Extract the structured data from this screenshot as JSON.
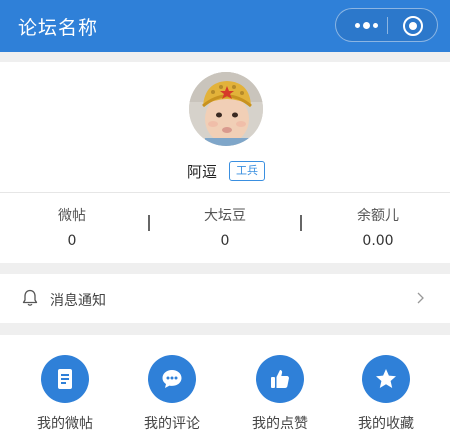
{
  "header": {
    "title": "论坛名称",
    "brand_color": "#2f80d8",
    "capsule": {
      "more_icon": "more-dots-icon",
      "close_icon": "target-close-icon"
    }
  },
  "profile": {
    "avatar_icon": "avatar-photo",
    "username": "阿逗",
    "rank": "工兵"
  },
  "stats": [
    {
      "label": "微帖",
      "value": "0"
    },
    {
      "label": "大坛豆",
      "value": "0"
    },
    {
      "label": "余额儿",
      "value": "0.00"
    }
  ],
  "notice": {
    "label": "消息通知",
    "icon": "bell-icon",
    "arrow_icon": "chevron-right-icon"
  },
  "menu": [
    {
      "label": "我的微帖",
      "icon": "document-icon"
    },
    {
      "label": "我的评论",
      "icon": "comment-icon"
    },
    {
      "label": "我的点赞",
      "icon": "thumbs-up-icon"
    },
    {
      "label": "我的收藏",
      "icon": "star-icon"
    }
  ]
}
